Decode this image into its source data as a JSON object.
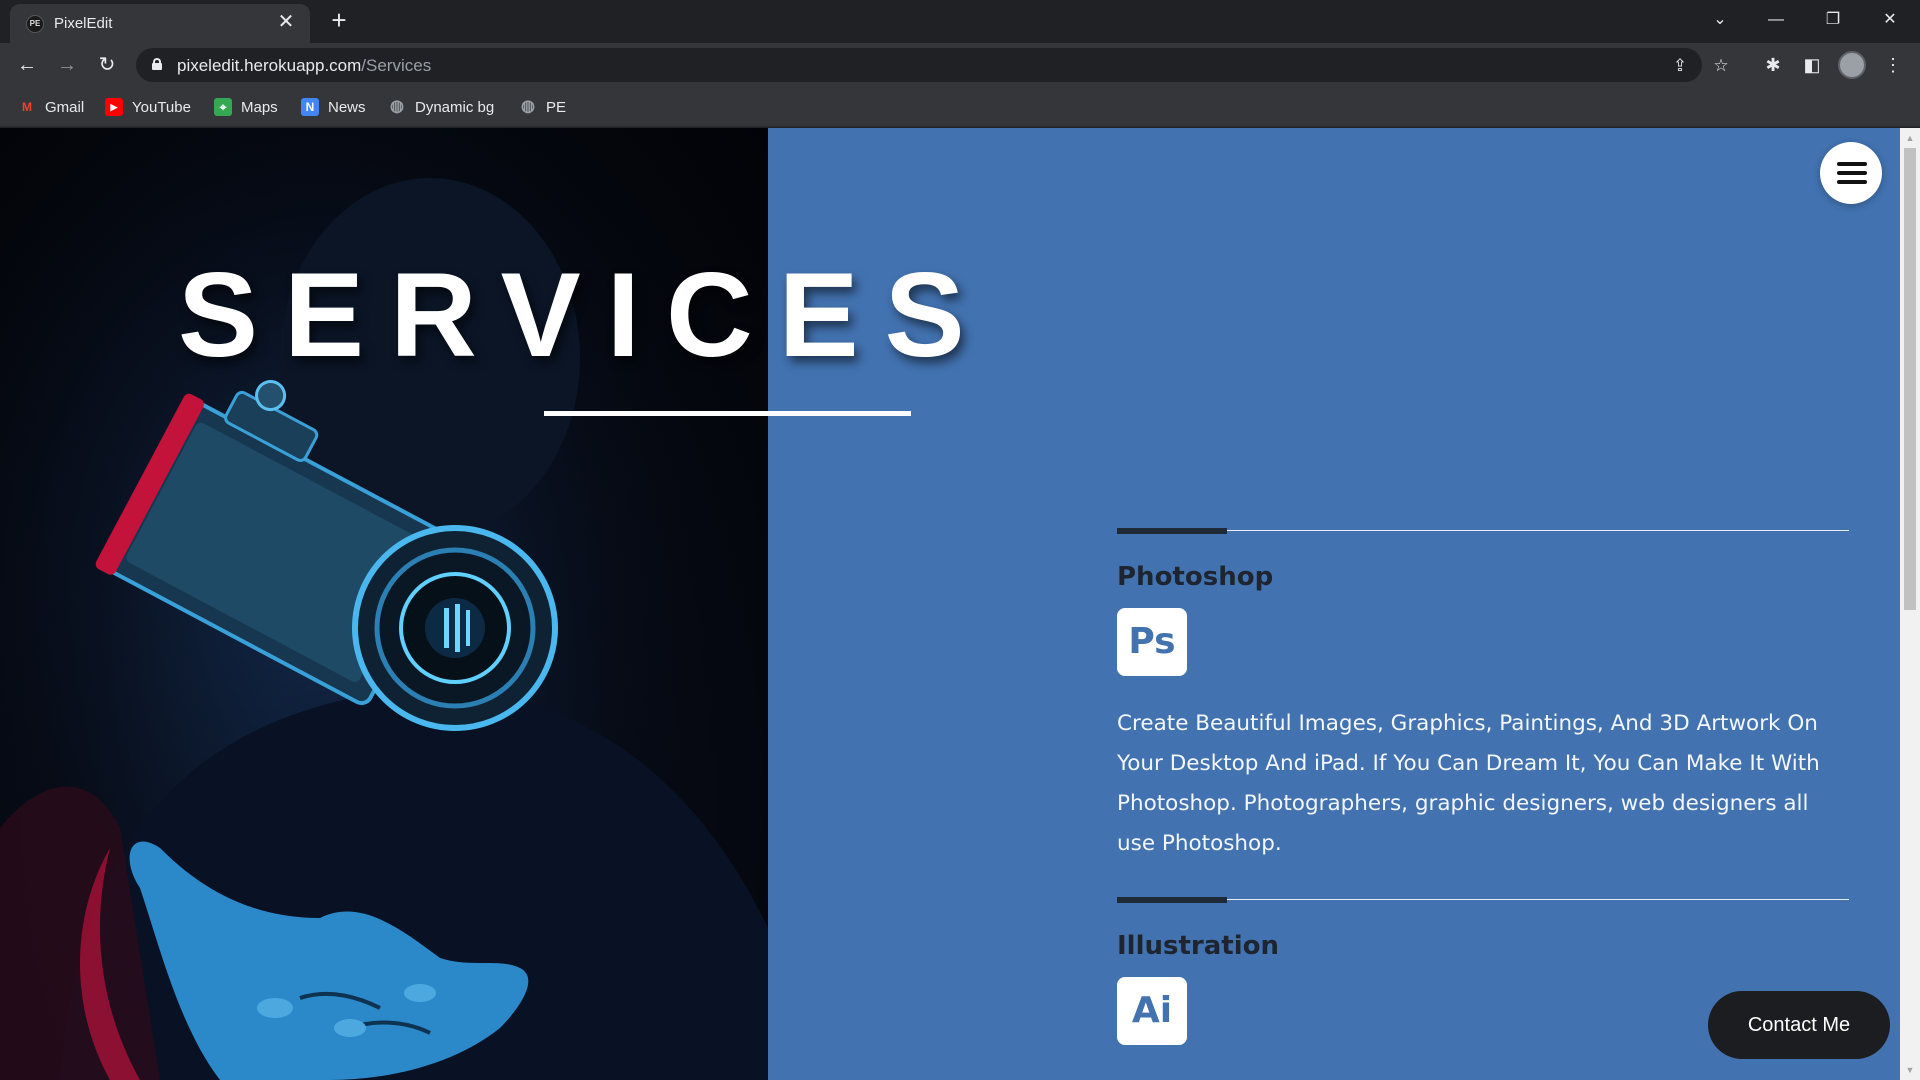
{
  "browser": {
    "tab": {
      "title": "PixelEdit",
      "favicon": "PE",
      "close_glyph": "✕"
    },
    "new_tab_glyph": "+",
    "window_controls": {
      "tab_search": "⌄",
      "minimize": "—",
      "restore": "❐",
      "close": "✕"
    },
    "nav": {
      "back": "←",
      "forward": "→",
      "reload": "↻"
    },
    "url": {
      "host": "pixeledit.herokuapp.com",
      "path": "/Services"
    },
    "omnibox_icons": {
      "share": "⇪",
      "bookmark": "☆"
    },
    "toolbar_icons": {
      "extensions": "✱",
      "side_panel": "◧",
      "menu": "⋮"
    },
    "bookmarks": [
      {
        "label": "Gmail",
        "icon": "M",
        "color": "#ea4335"
      },
      {
        "label": "YouTube",
        "icon": "▶",
        "color": "#ff0000"
      },
      {
        "label": "Maps",
        "icon": "⌖",
        "color": "#34a853"
      },
      {
        "label": "News",
        "icon": "N",
        "color": "#4285f4"
      },
      {
        "label": "Dynamic bg",
        "icon": "◍",
        "color": "#9aa0a6"
      },
      {
        "label": "PE",
        "icon": "◍",
        "color": "#9aa0a6"
      }
    ]
  },
  "page": {
    "title": "SERVICES",
    "accent_color": "#4272b0",
    "services": [
      {
        "name": "Photoshop",
        "logo": "Ps",
        "description": "Create Beautiful Images, Graphics, Paintings, And 3D Artwork On Your Desktop And iPad. If You Can Dream It, You Can Make It With Photoshop. Photographers, graphic designers, web designers all use Photoshop."
      },
      {
        "name": "Illustration",
        "logo": "Ai",
        "description": ""
      }
    ],
    "contact_label": "Contact Me"
  }
}
